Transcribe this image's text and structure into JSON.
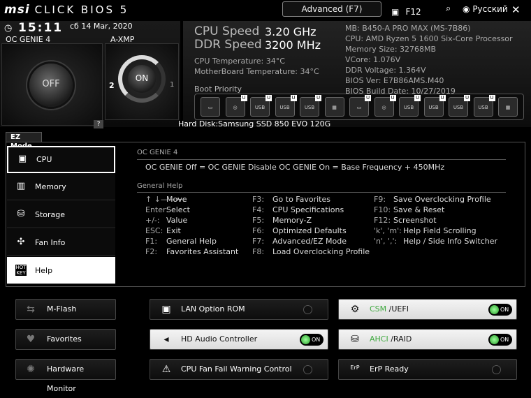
{
  "header": {
    "logo_brand": "msi",
    "logo_product": "CLICK BIOS 5",
    "mode_button": "Advanced (F7)",
    "screenshot_key": "F12",
    "language": "Русский",
    "close_symbol": "✕"
  },
  "clock": {
    "time": "15:11",
    "date": "сб  14 Mar, 2020"
  },
  "oc_genie": {
    "label": "OC GENIE 4",
    "state": "OFF"
  },
  "axmp": {
    "label": "A-XMP",
    "state": "ON",
    "profile_left": "2",
    "profile_right": "1"
  },
  "help_badge": "?",
  "speeds": {
    "cpu_label": "CPU Speed",
    "cpu_value": "3.20 GHz",
    "ddr_label": "DDR Speed",
    "ddr_value": "3200 MHz",
    "cpu_temp": "CPU Temperature: 34°C",
    "mb_temp": "MotherBoard Temperature: 34°C"
  },
  "sysinfo": {
    "mb": "MB: B450-A PRO MAX (MS-7B86)",
    "cpu": "CPU: AMD Ryzen 5 1600 Six-Core Processor",
    "memory": "Memory Size: 32768MB",
    "vcore": "VCore: 1.076V",
    "ddr_voltage": "DDR Voltage: 1.364V",
    "bios_ver": "BIOS Ver: E7B86AMS.M40",
    "bios_date": "BIOS Build Date: 10/27/2019"
  },
  "boot": {
    "title": "Boot Priority",
    "caption": "Hard Disk:Samsung SSD 850 EVO 120G",
    "devices": [
      {
        "type": "hdd-icon",
        "text": "",
        "u": false
      },
      {
        "type": "optical-icon",
        "text": "",
        "u": true
      },
      {
        "type": "usb-icon",
        "text": "USB",
        "u": true
      },
      {
        "type": "usb-icon",
        "text": "USB",
        "u": true
      },
      {
        "type": "usb-icon",
        "text": "USB",
        "u": true
      },
      {
        "type": "network-icon",
        "text": "",
        "u": false
      },
      {
        "type": "hdd-icon",
        "text": "",
        "u": true
      },
      {
        "type": "optical-icon",
        "text": "",
        "u": true
      },
      {
        "type": "usb-icon",
        "text": "USB",
        "u": true
      },
      {
        "type": "usb-icon",
        "text": "USB",
        "u": true
      },
      {
        "type": "usb-icon",
        "text": "USB",
        "u": true
      },
      {
        "type": "usb-icon",
        "text": "USB",
        "u": true
      },
      {
        "type": "network-icon",
        "text": "",
        "u": false
      }
    ]
  },
  "ez": {
    "label": "EZ Mode",
    "nav": [
      "CPU",
      "Memory",
      "Storage",
      "Fan Info",
      "Help"
    ],
    "oc_title": "OC GENIE 4",
    "oc_desc": "OC GENIE Off = OC GENIE Disable   OC GENIE On = Base Frequency + 450MHz",
    "help_title": "General Help",
    "help_col1": [
      {
        "k": "↑ ↓——←:",
        "v": "Move"
      },
      {
        "k": "Enter:",
        "v": "Select"
      },
      {
        "k": "+/-:",
        "v": "Value"
      },
      {
        "k": "ESC:",
        "v": "Exit"
      },
      {
        "k": "F1:",
        "v": "General Help"
      },
      {
        "k": "F2:",
        "v": "Favorites Assistant"
      }
    ],
    "help_col2": [
      {
        "k": "F3:",
        "v": "Go to Favorites"
      },
      {
        "k": "F4:",
        "v": "CPU Specifications"
      },
      {
        "k": "F5:",
        "v": "Memory-Z"
      },
      {
        "k": "F6:",
        "v": "Optimized Defaults"
      },
      {
        "k": "F7:",
        "v": "Advanced/EZ Mode"
      },
      {
        "k": "F8:",
        "v": "Load Overclocking Profile"
      }
    ],
    "help_col3": [
      {
        "k": "F9:",
        "v": "Save Overclocking Profile"
      },
      {
        "k": "F10:",
        "v": "Save & Reset"
      },
      {
        "k": "F12:",
        "v": "Screenshot"
      },
      {
        "k": "'k', 'm':",
        "v": "Help Field Scrolling"
      },
      {
        "k": "'n', ',':",
        "v": "Help / Side Info Switcher"
      }
    ]
  },
  "tiles": {
    "mflash": "M-Flash",
    "favorites": "Favorites",
    "hwmon": "Hardware Monitor",
    "lan": "LAN Option ROM",
    "hdaudio": "HD Audio Controller",
    "cpufan": "CPU Fan Fail Warning Control",
    "csm_a": "CSM",
    "csm_b": " /UEFI",
    "ahci_a": "AHCI",
    "ahci_b": " /RAID",
    "erp": "ErP Ready",
    "on_text": "ON"
  }
}
